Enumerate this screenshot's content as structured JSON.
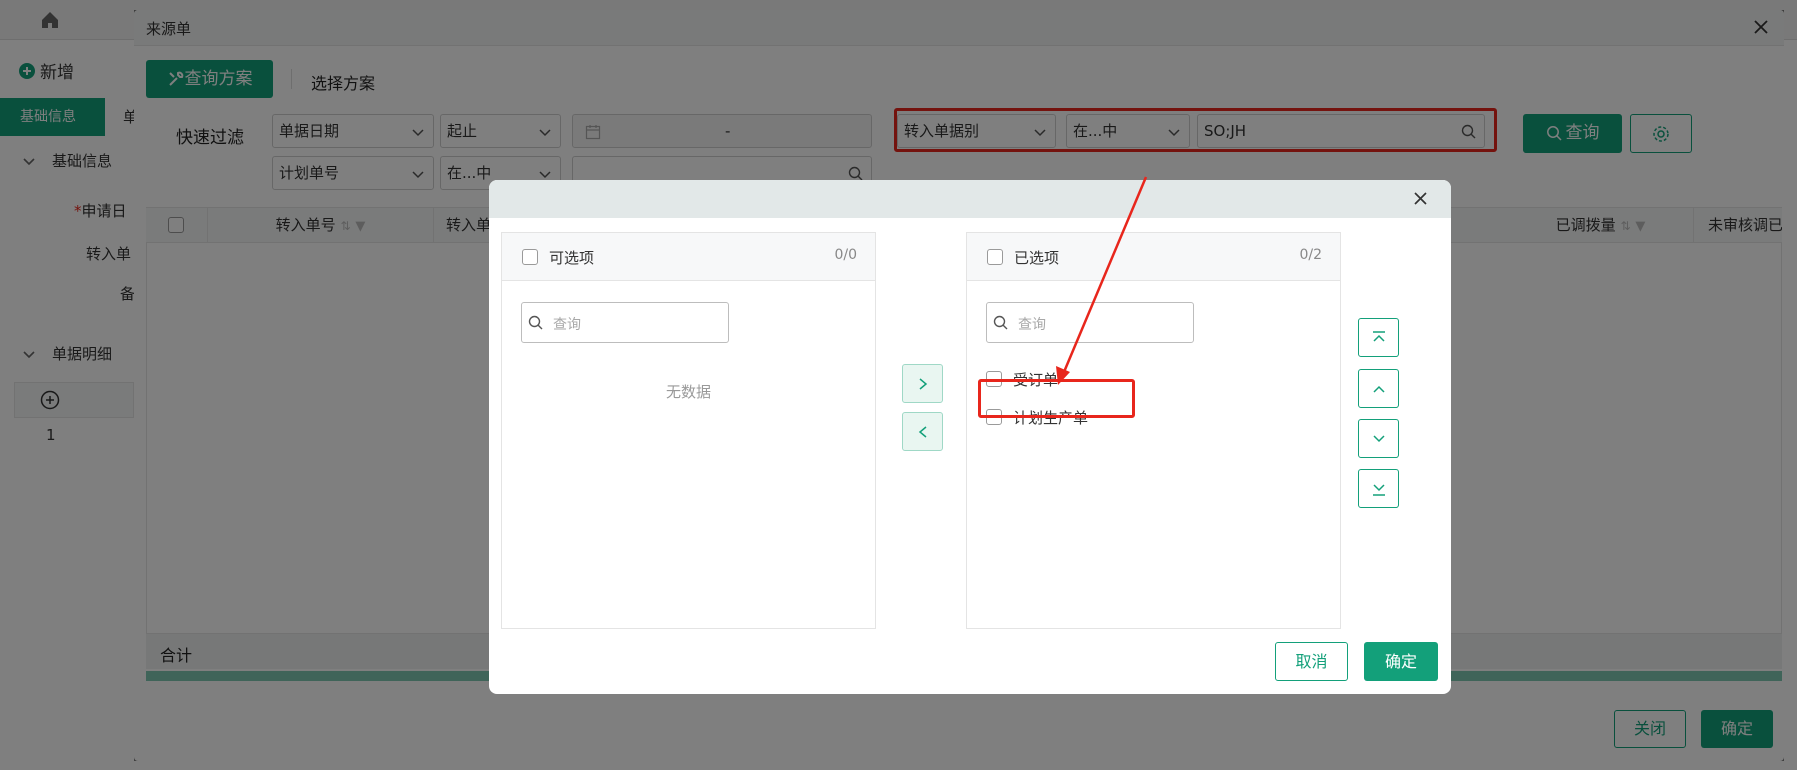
{
  "background_page": {
    "toolbar": {
      "add_label": "新增"
    },
    "tabs": [
      "基础信息",
      "单"
    ],
    "sections": [
      "基础信息",
      "单据明细"
    ],
    "labels": [
      "申请日",
      "转入单",
      "备"
    ],
    "row_number": "1"
  },
  "dialog": {
    "title": "来源单",
    "query_plan_label": "查询方案",
    "select_plan_label": "选择方案",
    "quick_filter_label": "快速过滤",
    "filters": {
      "date_field": "单据日期",
      "date_op": "起止",
      "date_range": "-",
      "plan_no_field": "计划单号",
      "plan_no_op": "在...中",
      "type_field": "转入单据别",
      "type_op": "在...中",
      "type_value": "SO;JH"
    },
    "search_label": "查询",
    "grid": {
      "columns": [
        "转入单号",
        "转入单",
        "已调拨量",
        "未审核调已"
      ],
      "sum_label": "合计"
    },
    "close_label": "关闭",
    "confirm_label": "确定"
  },
  "transfer_dialog": {
    "left_panel": {
      "title": "可选项",
      "count": "0/0",
      "search_placeholder": "查询",
      "empty_text": "无数据"
    },
    "right_panel": {
      "title": "已选项",
      "count": "0/2",
      "search_placeholder": "查询",
      "items": [
        "受订单",
        "计划生产单"
      ]
    },
    "cancel_label": "取消",
    "confirm_label": "确定"
  },
  "colors": {
    "accent": "#13a07a",
    "highlight": "#e8261c"
  }
}
